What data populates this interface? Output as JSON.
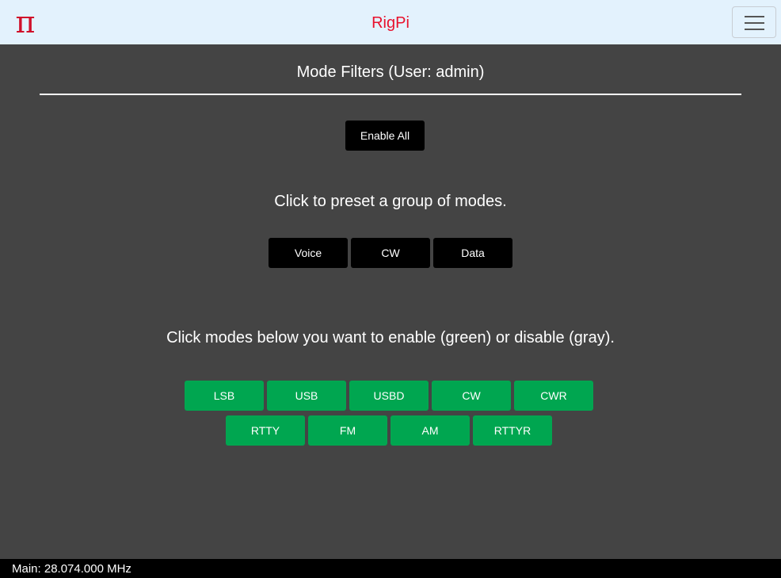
{
  "navbar": {
    "logo": "π",
    "brand": "RigPi",
    "menu_icon": "hamburger-menu-icon"
  },
  "page": {
    "title": "Mode Filters (User: admin)",
    "enable_all_label": "Enable All",
    "preset_instruction": "Click to preset a group of modes.",
    "presets": [
      "Voice",
      "CW",
      "Data"
    ],
    "mode_instruction": "Click modes below you want to enable (green) or disable (gray).",
    "modes_row1": [
      "LSB",
      "USB",
      "USBD",
      "CW",
      "CWR"
    ],
    "modes_row2": [
      "RTTY",
      "FM",
      "AM",
      "RTTYR"
    ]
  },
  "colors": {
    "enabled_green": "#00a650",
    "brand_red": "#e8112d",
    "background": "#444444"
  },
  "status": {
    "main_frequency": "Main: 28.074.000 MHz"
  }
}
